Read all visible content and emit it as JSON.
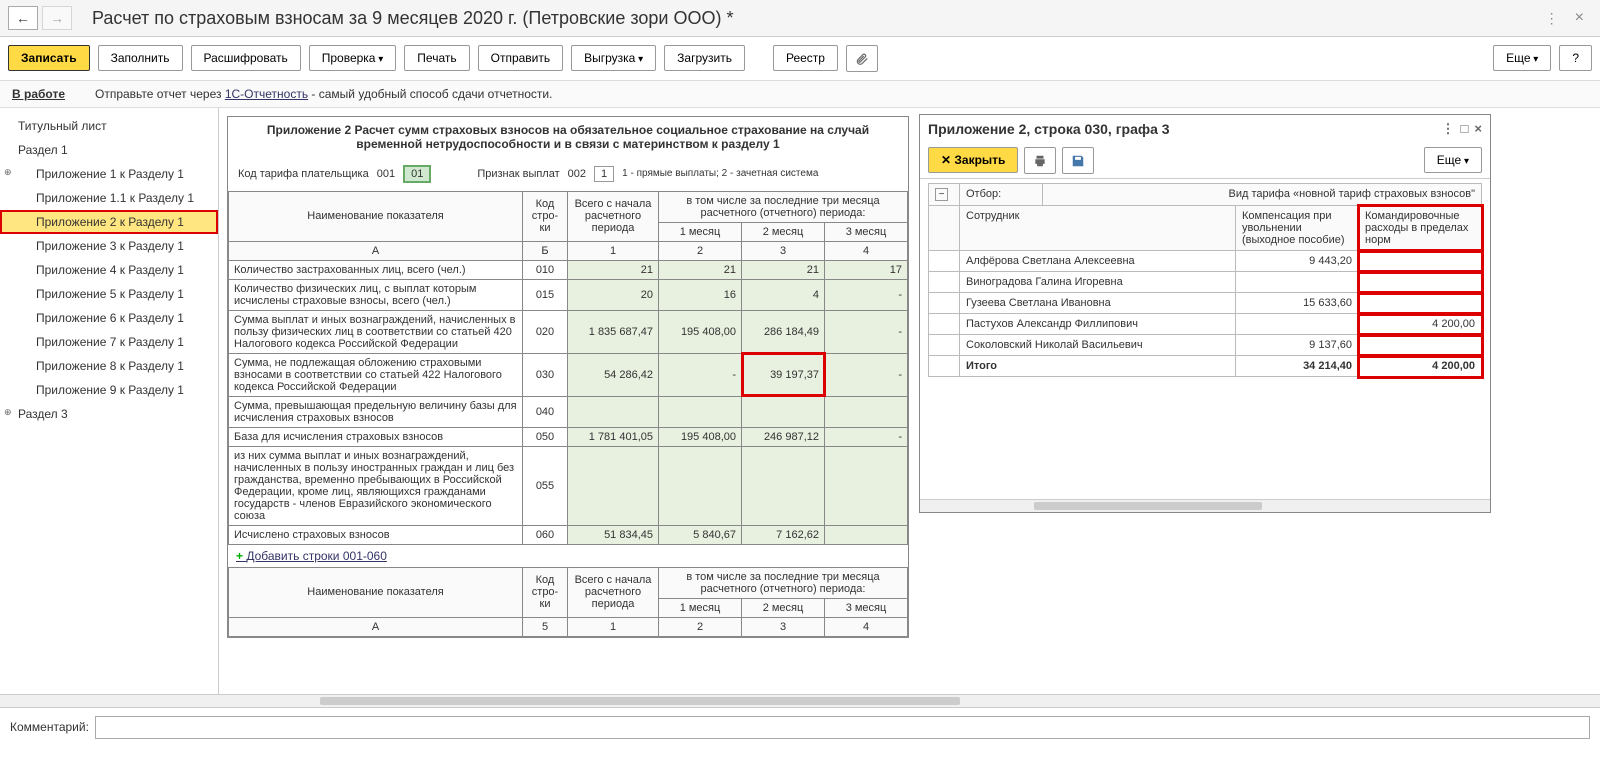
{
  "title": "Расчет по страховым взносам за 9 месяцев 2020 г. (Петровские зори ООО) *",
  "toolbar": {
    "save": "Записать",
    "fill": "Заполнить",
    "decode": "Расшифровать",
    "check": "Проверка",
    "print": "Печать",
    "send": "Отправить",
    "upload": "Выгрузка",
    "load": "Загрузить",
    "registry": "Реестр",
    "more": "Еще",
    "help": "?"
  },
  "status": {
    "work": "В работе",
    "text1": "Отправьте отчет через ",
    "link": "1С-Отчетность",
    "text2": " - самый удобный способ сдачи отчетности."
  },
  "sidebar": [
    {
      "label": "Титульный лист",
      "top": true
    },
    {
      "label": "Раздел 1",
      "top": true
    },
    {
      "label": "Приложение 1 к Разделу 1",
      "exp": true
    },
    {
      "label": "Приложение 1.1 к Разделу 1"
    },
    {
      "label": "Приложение 2 к Разделу 1",
      "sel": true
    },
    {
      "label": "Приложение 3 к Разделу 1"
    },
    {
      "label": "Приложение 4 к Разделу 1"
    },
    {
      "label": "Приложение 5 к Разделу 1"
    },
    {
      "label": "Приложение 6 к Разделу 1"
    },
    {
      "label": "Приложение 7 к Разделу 1"
    },
    {
      "label": "Приложение 8 к Разделу 1"
    },
    {
      "label": "Приложение 9 к Разделу 1"
    },
    {
      "label": "Раздел 3",
      "top": true,
      "exp": true
    }
  ],
  "report": {
    "title": "Приложение 2 Расчет сумм страховых взносов на обязательное социальное страхование на случай временной нетрудоспособности и в связи с материнством к разделу 1",
    "param1_label": "Код тарифа плательщика",
    "param1_code": "001",
    "param1_val": "01",
    "param2_label": "Признак выплат",
    "param2_code": "002",
    "param2_val": "1",
    "param2_hint": "1 - прямые выплаты; 2 - зачетная система",
    "hdr": {
      "name": "Наименование показателя",
      "code": "Код стро-ки",
      "total": "Всего с начала расчетного периода",
      "last3": "в том числе за последние три месяца расчетного (отчетного) периода:",
      "m1": "1 месяц",
      "m2": "2 месяц",
      "m3": "3 месяц",
      "colA": "А",
      "colB": "Б",
      "c1": "1",
      "c2": "2",
      "c3": "3",
      "c4": "4"
    },
    "rows": [
      {
        "name": "Количество застрахованных лиц, всего (чел.)",
        "code": "010",
        "v1": "21",
        "v2": "21",
        "v3": "21",
        "v4": "17"
      },
      {
        "name": "Количество физических лиц, с выплат которым исчислены страховые взносы, всего (чел.)",
        "code": "015",
        "v1": "20",
        "v2": "16",
        "v3": "4",
        "v4": "-"
      },
      {
        "name": "Сумма выплат и иных вознаграждений, начисленных в пользу физических лиц в соответствии со статьей 420 Налогового кодекса Российской Федерации",
        "code": "020",
        "v1": "1 835 687,47",
        "v2": "195 408,00",
        "v3": "286 184,49",
        "v4": "-"
      },
      {
        "name": "Сумма, не подлежащая обложению страховыми взносами в соответствии со статьей 422 Налогового кодекса Российской Федерации",
        "code": "030",
        "v1": "54 286,42",
        "v2": "-",
        "v3": "39 197,37",
        "v4": "-",
        "hl": true
      },
      {
        "name": "Сумма, превышающая предельную величину базы для исчисления страховых взносов",
        "code": "040",
        "v1": "",
        "v2": "",
        "v3": "",
        "v4": ""
      },
      {
        "name": "База для исчисления страховых взносов",
        "code": "050",
        "v1": "1 781 401,05",
        "v2": "195 408,00",
        "v3": "246 987,12",
        "v4": "-"
      },
      {
        "name": "из них сумма выплат и иных вознаграждений, начисленных в пользу иностранных граждан и лиц без гражданства, временно пребывающих в Российской Федерации, кроме лиц, являющихся гражданами государств - членов Евразийского экономического союза",
        "code": "055",
        "v1": "",
        "v2": "",
        "v3": "",
        "v4": ""
      },
      {
        "name": "Исчислено страховых взносов",
        "code": "060",
        "v1": "51 834,45",
        "v2": "5 840,67",
        "v3": "7 162,62",
        "v4": ""
      }
    ],
    "addlink": "Добавить строки 001-060",
    "hdr2_colB": "5",
    "hdr2_c1": "1",
    "hdr2_c2": "2",
    "hdr2_c3": "3",
    "hdr2_c4": "4"
  },
  "detail": {
    "title": "Приложение 2, строка 030, графа 3",
    "close": "Закрыть",
    "more": "Еще",
    "filter_label": "Отбор:",
    "filter_val": "Вид тарифа «новной тариф страховых взносов\"",
    "col_emp": "Сотрудник",
    "col_comp": "Компенсация при увольнении (выходное пособие)",
    "col_trip": "Командировочные расходы в пределах норм",
    "rows": [
      {
        "emp": "Алфёрова Светлана Алексеевна",
        "comp": "9 443,20",
        "trip": ""
      },
      {
        "emp": "Виноградова Галина Игоревна",
        "comp": "",
        "trip": ""
      },
      {
        "emp": "Гузеева Светлана Ивановна",
        "comp": "15 633,60",
        "trip": ""
      },
      {
        "emp": "Пастухов Александр Филлипович",
        "comp": "",
        "trip": "4 200,00"
      },
      {
        "emp": "Соколовский Николай Васильевич",
        "comp": "9 137,60",
        "trip": ""
      }
    ],
    "total_label": "Итого",
    "total_comp": "34 214,40",
    "total_trip": "4 200,00"
  },
  "comment_label": "Комментарий:"
}
